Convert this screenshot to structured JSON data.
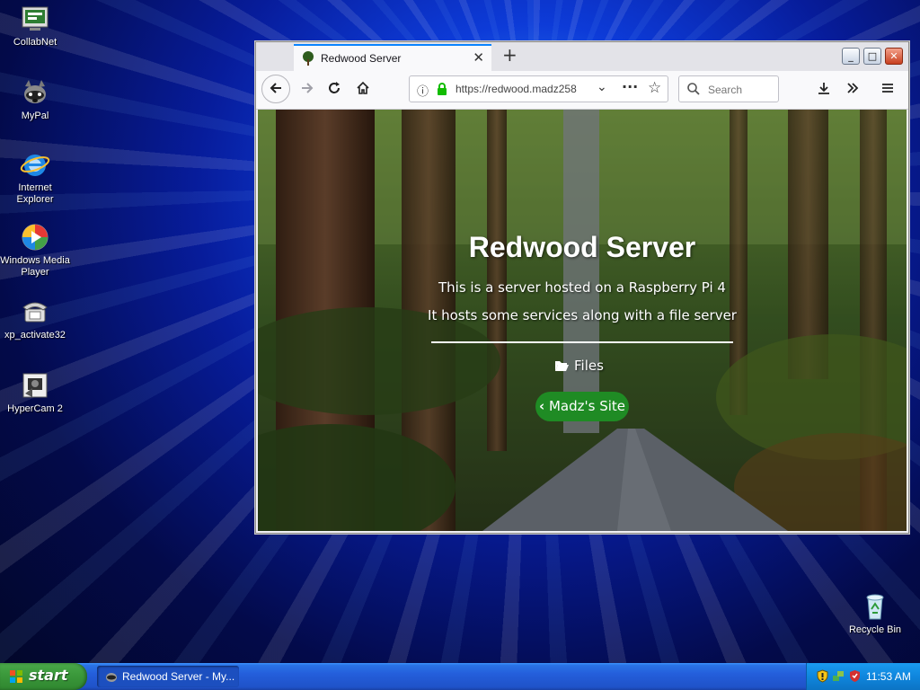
{
  "desktop": {
    "icons": [
      {
        "label": "CollabNet"
      },
      {
        "label": "MyPal"
      },
      {
        "label": "Internet Explorer"
      },
      {
        "label": "Windows Media Player"
      },
      {
        "label": "xp_activate32"
      },
      {
        "label": "HyperCam 2"
      },
      {
        "label": "Recycle Bin"
      }
    ]
  },
  "browser": {
    "tab": {
      "title": "Redwood Server",
      "close": "✕"
    },
    "new_tab": "+",
    "window_controls": {
      "minimize": "_",
      "maximize": "□",
      "close": "✕"
    },
    "url": "https://redwood.madz258",
    "search_placeholder": "Search"
  },
  "page": {
    "heading": "Redwood Server",
    "line1": "This is a server hosted on a Raspberry Pi 4",
    "line2": "It hosts some services along with a file server",
    "files_link": "Files",
    "site_button": "Madz's Site"
  },
  "taskbar": {
    "start": "start",
    "task_item": "Redwood Server - My...",
    "clock": "11:53 AM"
  },
  "colors": {
    "site_button": "#1f8b24",
    "start_button": "#3c9a3c",
    "taskbar": "#245edb",
    "tab_accent": "#0a84ff"
  }
}
